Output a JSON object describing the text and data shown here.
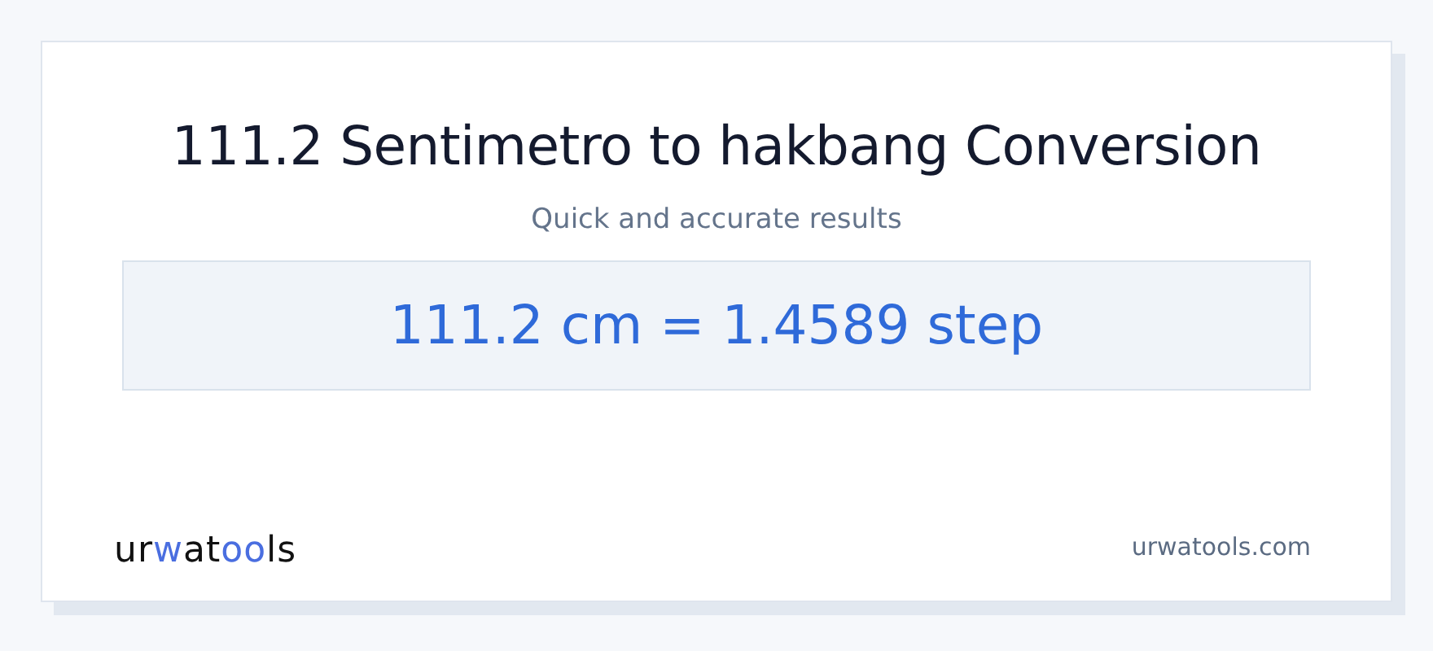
{
  "title": "111.2 Sentimetro to hakbang Conversion",
  "subtitle": "Quick and accurate results",
  "result": "111.2 cm = 1.4589 step",
  "logo": {
    "parts": [
      {
        "text": "ur",
        "accent": false
      },
      {
        "text": "w",
        "accent": true
      },
      {
        "text": "at",
        "accent": false
      },
      {
        "text": "oo",
        "accent": true
      },
      {
        "text": "ls",
        "accent": false
      }
    ]
  },
  "domain": "urwatools.com"
}
